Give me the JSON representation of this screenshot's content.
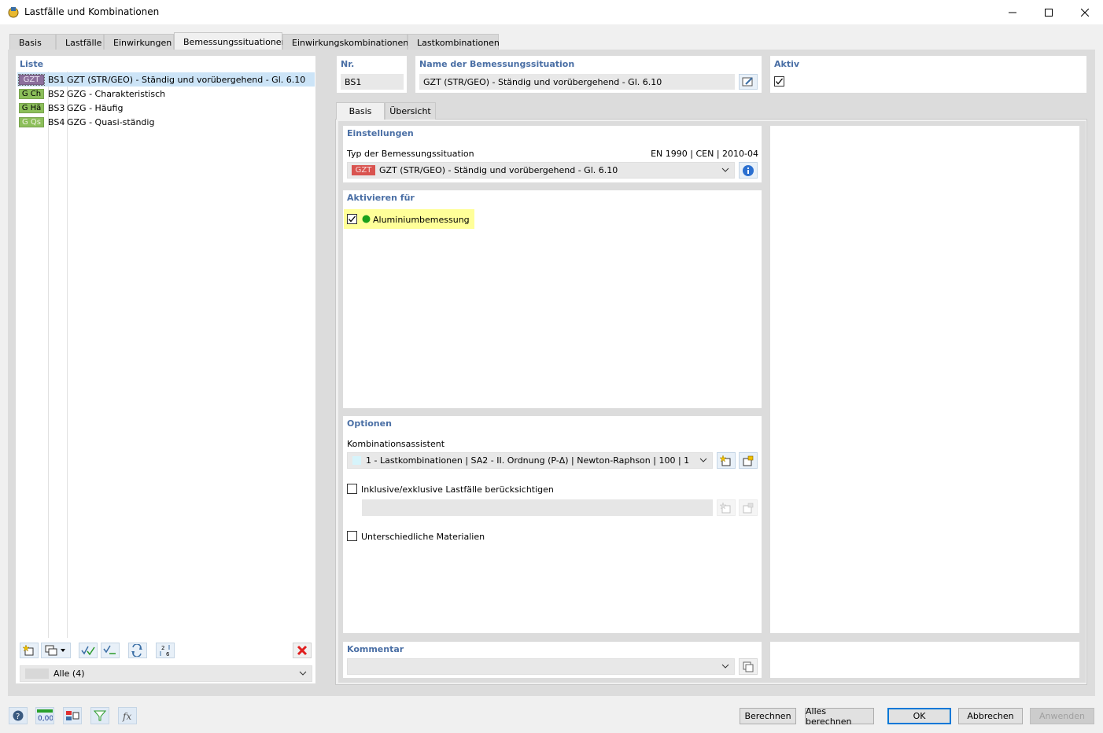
{
  "window": {
    "title": "Lastfälle und Kombinationen"
  },
  "tabs": [
    "Basis",
    "Lastfälle",
    "Einwirkungen",
    "Bemessungssituationen",
    "Einwirkungskombinationen",
    "Lastkombinationen"
  ],
  "left": {
    "title": "Liste",
    "items": [
      {
        "badge": "GZT",
        "badge_color": "#8b6f9c",
        "badge_text_color": "#e8e0f0",
        "nr": "BS1",
        "name": "GZT (STR/GEO) - Ständig und vorübergehend - Gl. 6.10"
      },
      {
        "badge": "G Ch",
        "badge_color": "#8cbf5a",
        "badge_text_color": "#000000",
        "nr": "BS2",
        "name": "GZG - Charakteristisch"
      },
      {
        "badge": "G Hä",
        "badge_color": "#8cbf5a",
        "badge_text_color": "#000000",
        "nr": "BS3",
        "name": "GZG - Häufig"
      },
      {
        "badge": "G Qs",
        "badge_color": "#8cbf5a",
        "badge_text_color": "#f0f0e0",
        "nr": "BS4",
        "name": "GZG - Quasi-ständig"
      }
    ],
    "filter": "Alle (4)"
  },
  "header": {
    "nr_label": "Nr.",
    "nr_value": "BS1",
    "name_label": "Name der Bemessungssituation",
    "name_value": "GZT (STR/GEO) - Ständig und vorübergehend - Gl. 6.10",
    "aktiv_label": "Aktiv"
  },
  "subtabs": [
    "Basis",
    "Übersicht"
  ],
  "einstellungen": {
    "title": "Einstellungen",
    "typ_label": "Typ der Bemessungssituation",
    "norm": "EN 1990 | CEN | 2010-04",
    "typ_badge": "GZT",
    "typ_value": "GZT (STR/GEO) - Ständig und vorübergehend - Gl. 6.10"
  },
  "aktivieren": {
    "title": "Aktivieren für",
    "item": "Aluminiumbemessung"
  },
  "optionen": {
    "title": "Optionen",
    "kombi_label": "Kombinationsassistent",
    "kombi_value": "1 - Lastkombinationen | SA2 - II. Ordnung (P-Δ) | Newton-Raphson | 100 | 1",
    "inkl_label": "Inklusive/exklusive Lastfälle berücksichtigen",
    "mat_label": "Unterschiedliche Materialien"
  },
  "kommentar": {
    "title": "Kommentar"
  },
  "buttons": {
    "berechnen": "Berechnen",
    "alles": "Alles berechnen",
    "ok": "OK",
    "abbrechen": "Abbrechen",
    "anwenden": "Anwenden"
  },
  "bottom_icons": {
    "number_icon_text": "0,00"
  }
}
